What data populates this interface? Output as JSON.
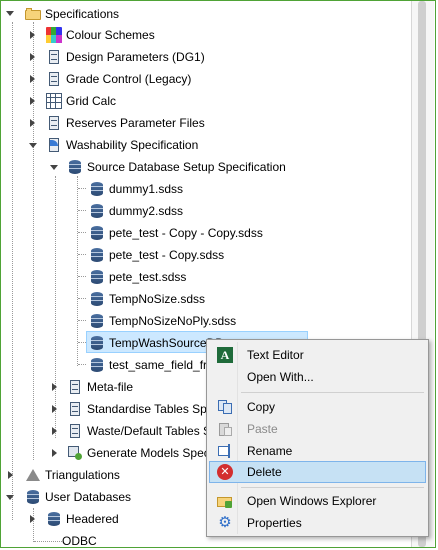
{
  "tree": {
    "specifications": {
      "label": "Specifications"
    },
    "colour_schemes": {
      "label": "Colour Schemes"
    },
    "design_parameters": {
      "label": "Design Parameters (DG1)"
    },
    "grade_control": {
      "label": "Grade Control (Legacy)"
    },
    "grid_calc": {
      "label": "Grid Calc"
    },
    "reserves_parameter_files": {
      "label": "Reserves Parameter Files"
    },
    "washability_specification": {
      "label": "Washability Specification"
    },
    "source_db_setup": {
      "label": "Source Database Setup Specification"
    },
    "files": [
      {
        "label": "dummy1.sdss"
      },
      {
        "label": "dummy2.sdss"
      },
      {
        "label": "pete_test - Copy - Copy.sdss"
      },
      {
        "label": "pete_test - Copy.sdss"
      },
      {
        "label": "pete_test.sdss"
      },
      {
        "label": "TempNoSize.sdss"
      },
      {
        "label": "TempNoSizeNoPly.sdss"
      },
      {
        "label": "TempWashSourceDB"
      },
      {
        "label": "test_same_field_fra"
      }
    ],
    "meta_file": {
      "label": "Meta-file"
    },
    "standardise_tables": {
      "label": "Standardise Tables Spe"
    },
    "waste_default_tables": {
      "label": "Waste/Default Tables S"
    },
    "generate_models": {
      "label": "Generate Models Speci"
    },
    "triangulations": {
      "label": "Triangulations"
    },
    "user_databases": {
      "label": "User Databases"
    },
    "headered": {
      "label": "Headered"
    },
    "odbc": {
      "label": "ODBC"
    }
  },
  "context_menu": {
    "text_editor": {
      "label": "Text Editor",
      "icon": "text-editor-icon",
      "glyph": "A"
    },
    "open_with": {
      "label": "Open With..."
    },
    "copy": {
      "label": "Copy",
      "icon": "copy-icon"
    },
    "paste": {
      "label": "Paste",
      "icon": "paste-icon",
      "enabled": false
    },
    "rename": {
      "label": "Rename",
      "icon": "rename-icon"
    },
    "delete": {
      "label": "Delete",
      "icon": "delete-icon",
      "glyph": "✕",
      "highlighted": true
    },
    "open_windows_explorer": {
      "label": "Open Windows Explorer",
      "icon": "explorer-icon"
    },
    "properties": {
      "label": "Properties",
      "icon": "gear-icon",
      "glyph": "⚙"
    }
  },
  "colors": {
    "selection_bg": "#cce8ff",
    "menu_highlight": "#c6e1f4",
    "frame_border": "#4fa336"
  }
}
